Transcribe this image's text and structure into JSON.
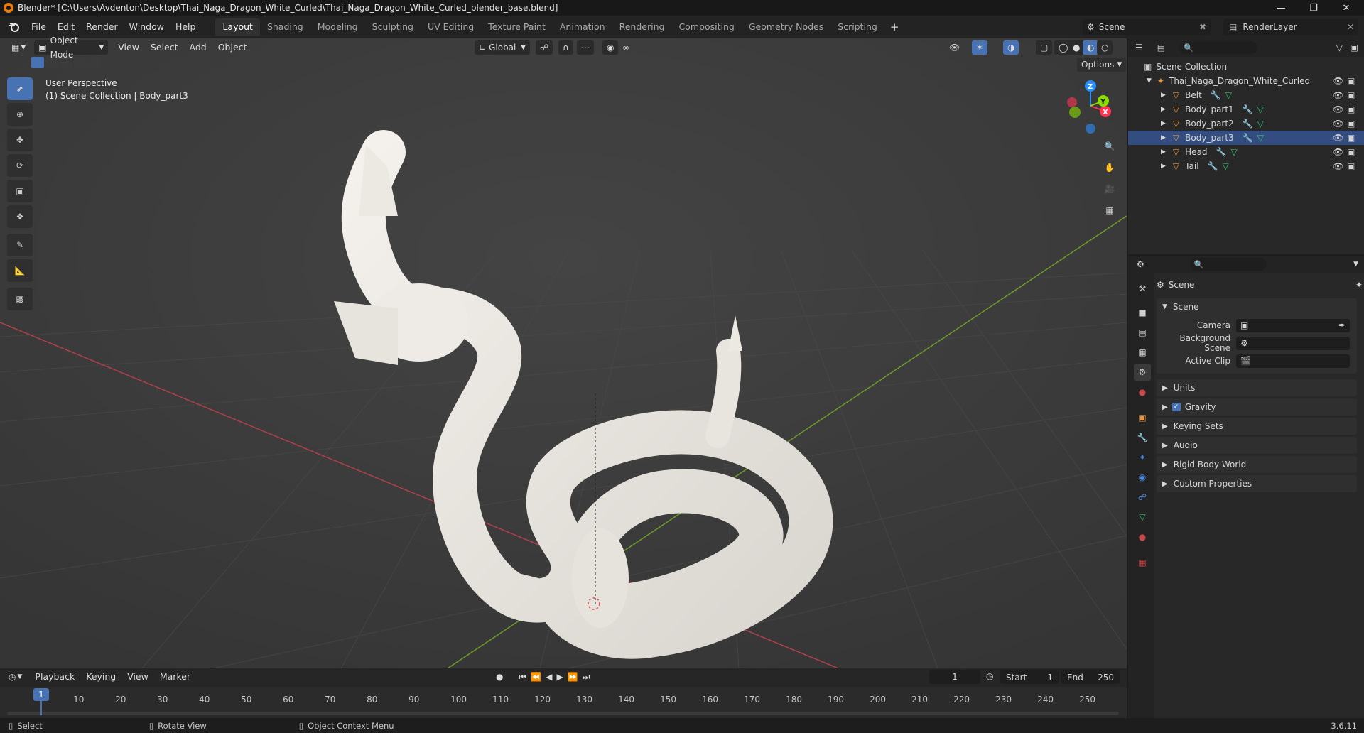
{
  "window": {
    "title": "Blender* [C:\\Users\\Avdenton\\Desktop\\Thai_Naga_Dragon_White_Curled\\Thai_Naga_Dragon_White_Curled_blender_base.blend]"
  },
  "menu": [
    "File",
    "Edit",
    "Render",
    "Window",
    "Help"
  ],
  "workspaces": [
    "Layout",
    "Shading",
    "Modeling",
    "Sculpting",
    "UV Editing",
    "Texture Paint",
    "Animation",
    "Rendering",
    "Compositing",
    "Geometry Nodes",
    "Scripting"
  ],
  "active_workspace": "Layout",
  "scene_name": "Scene",
  "render_layer": "RenderLayer",
  "viewport": {
    "mode": "Object Mode",
    "menus": [
      "View",
      "Select",
      "Add",
      "Object"
    ],
    "orientation": "Global",
    "options_label": "Options",
    "info_line1": "User Perspective",
    "info_line2": "(1) Scene Collection | Body_part3",
    "gizmo_axes": [
      "Z",
      "Y",
      "X"
    ]
  },
  "outliner": {
    "root": "Scene Collection",
    "collection": "Thai_Naga_Dragon_White_Curled",
    "objects": [
      "Belt",
      "Body_part1",
      "Body_part2",
      "Body_part3",
      "Head",
      "Tail"
    ],
    "selected": "Body_part3"
  },
  "properties": {
    "context": "Scene",
    "section": "Scene",
    "fields": [
      {
        "label": "Camera",
        "value": ""
      },
      {
        "label": "Background Scene",
        "value": ""
      },
      {
        "label": "Active Clip",
        "value": ""
      }
    ],
    "panels": [
      "Units",
      "Gravity",
      "Keying Sets",
      "Audio",
      "Rigid Body World",
      "Custom Properties"
    ],
    "gravity_checked": true
  },
  "timeline": {
    "menus": [
      "Playback",
      "Keying",
      "View",
      "Marker"
    ],
    "current_frame": "1",
    "start_label": "Start",
    "start": "1",
    "end_label": "End",
    "end": "250",
    "ticks": [
      "10",
      "20",
      "30",
      "40",
      "50",
      "60",
      "70",
      "80",
      "90",
      "100",
      "110",
      "120",
      "130",
      "140",
      "150",
      "160",
      "170",
      "180",
      "190",
      "200",
      "210",
      "220",
      "230",
      "240",
      "250"
    ],
    "playhead": "1"
  },
  "status": {
    "items": [
      "Select",
      "Rotate View",
      "Object Context Menu"
    ],
    "version": "3.6.11"
  },
  "colors": {
    "accent": "#4772b3",
    "x_axis": "#ff3352",
    "y_axis": "#8bdc00",
    "z_axis": "#2890ff",
    "object_orange": "#e8923a",
    "mesh_green": "#30c070"
  }
}
